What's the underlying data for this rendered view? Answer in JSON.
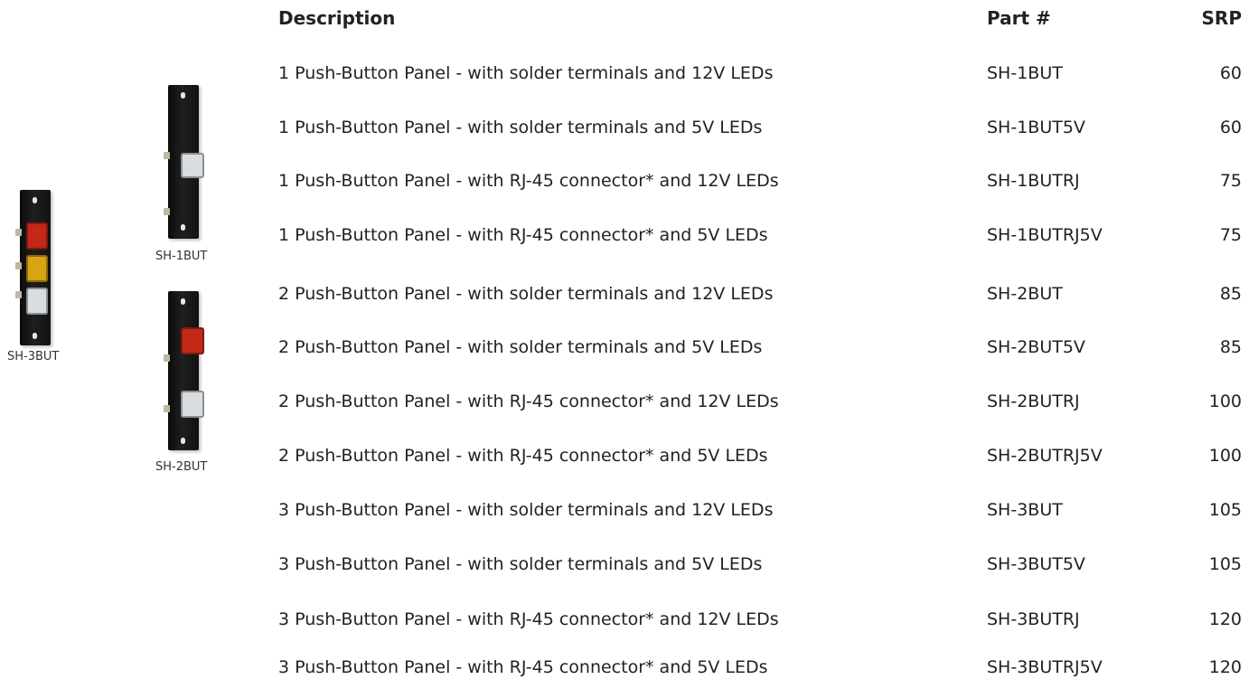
{
  "products": [
    {
      "caption": "SH-3BUT",
      "buttons": [
        "#c42818",
        "#d9a312",
        "#d9dde0"
      ]
    },
    {
      "caption": "SH-1BUT",
      "buttons": [
        "#d9dde0"
      ]
    },
    {
      "caption": "SH-2BUT",
      "buttons": [
        "#c42818",
        "#d9dde0"
      ]
    }
  ],
  "table": {
    "headers": {
      "description": "Description",
      "part": "Part #",
      "srp": "SRP"
    },
    "rows": [
      {
        "description": "1 Push-Button Panel - with solder terminals and 12V LEDs",
        "part": "SH-1BUT",
        "srp": "60"
      },
      {
        "description": "1 Push-Button Panel - with solder terminals and 5V LEDs",
        "part": "SH-1BUT5V",
        "srp": "60"
      },
      {
        "description": "1 Push-Button Panel - with RJ-45 connector* and 12V LEDs",
        "part": "SH-1BUTRJ",
        "srp": "75"
      },
      {
        "description": "1 Push-Button Panel - with RJ-45 connector* and 5V LEDs",
        "part": "SH-1BUTRJ5V",
        "srp": "75"
      },
      {
        "description": "2 Push-Button Panel - with solder terminals and 12V LEDs",
        "part": "SH-2BUT",
        "srp": "85"
      },
      {
        "description": "2 Push-Button Panel - with solder terminals and 5V LEDs",
        "part": "SH-2BUT5V",
        "srp": "85"
      },
      {
        "description": "2 Push-Button Panel - with RJ-45 connector* and 12V LEDs",
        "part": "SH-2BUTRJ",
        "srp": "100"
      },
      {
        "description": "2 Push-Button Panel - with RJ-45 connector* and 5V LEDs",
        "part": "SH-2BUTRJ5V",
        "srp": "100"
      },
      {
        "description": "3 Push-Button Panel - with solder terminals and 12V LEDs",
        "part": "SH-3BUT",
        "srp": "105"
      },
      {
        "description": "3 Push-Button Panel - with solder terminals and 5V LEDs",
        "part": "SH-3BUT5V",
        "srp": "105"
      },
      {
        "description": "3 Push-Button Panel - with RJ-45 connector* and 12V LEDs",
        "part": "SH-3BUTRJ",
        "srp": "120"
      },
      {
        "description": "3 Push-Button Panel - with RJ-45 connector* and 5V LEDs",
        "part": "SH-3BUTRJ5V",
        "srp": "120"
      }
    ]
  }
}
